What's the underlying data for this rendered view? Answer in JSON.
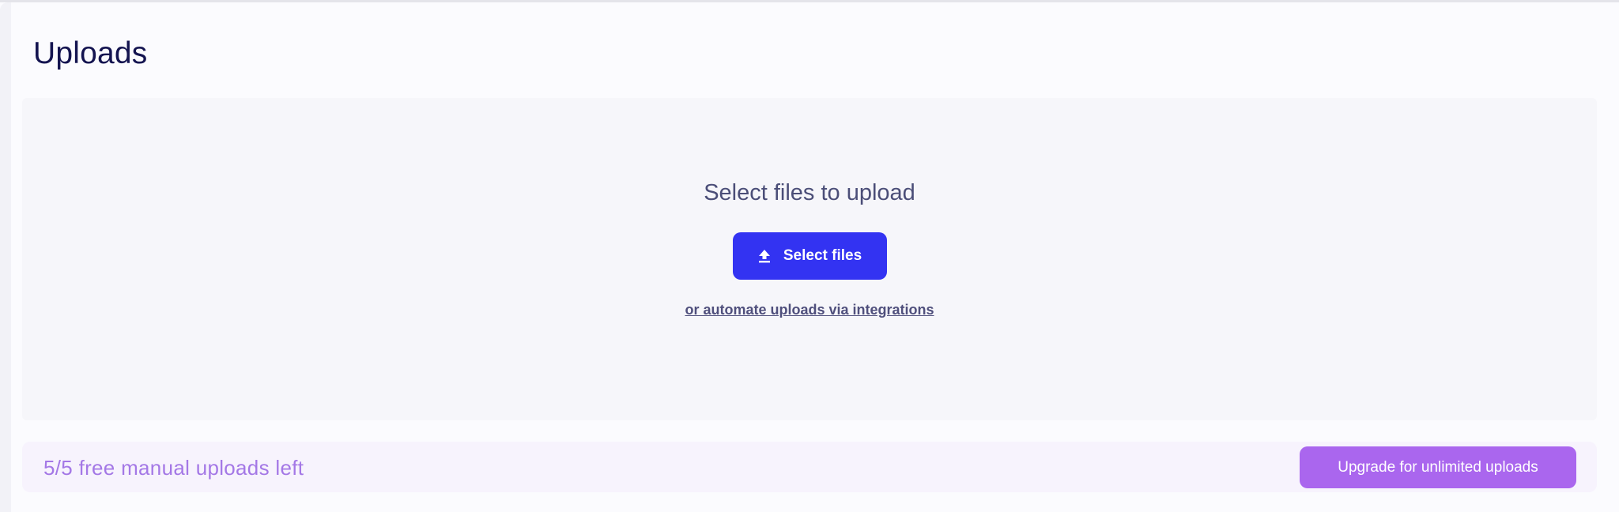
{
  "page": {
    "title": "Uploads"
  },
  "dropzone": {
    "heading": "Select files to upload",
    "select_button_label": "Select files",
    "select_button_icon": "upload-icon",
    "integrations_link": "or automate uploads via integrations"
  },
  "footer": {
    "uploads_left_text": "5/5 free manual uploads left",
    "upgrade_button_label": "Upgrade for unlimited uploads"
  },
  "colors": {
    "title": "#141450",
    "primary_button": "#3333f2",
    "upgrade_button": "#aa66ee",
    "uploads_left_text": "#a478e6",
    "dropzone_bg": "#f6f6fa",
    "footer_bg": "#f7f3fd"
  }
}
